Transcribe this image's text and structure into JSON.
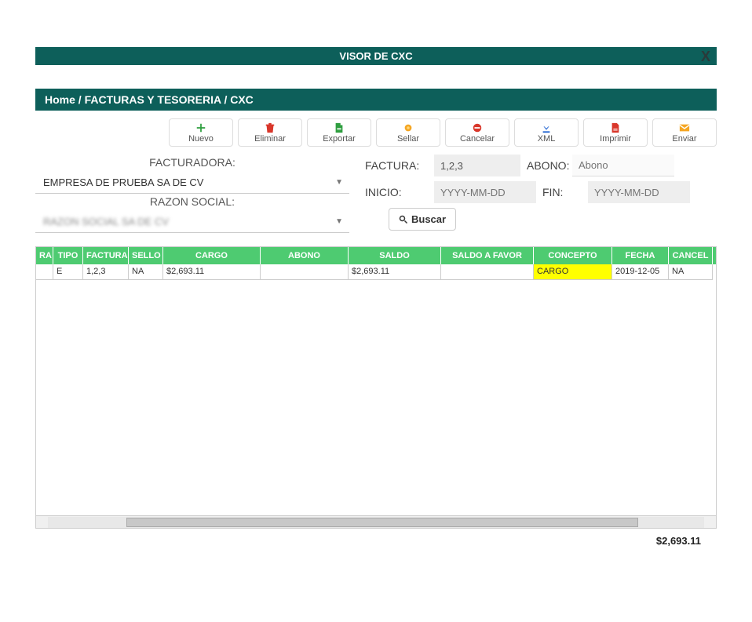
{
  "titlebar": {
    "title": "VISOR DE CXC",
    "close": "X"
  },
  "breadcrumb": "Home / FACTURAS Y TESORERIA / CXC",
  "toolbar": {
    "nuevo": "Nuevo",
    "eliminar": "Eliminar",
    "exportar": "Exportar",
    "sellar": "Sellar",
    "cancelar": "Cancelar",
    "xml": "XML",
    "imprimir": "Imprimir",
    "enviar": "Enviar"
  },
  "filters": {
    "facturadora_label": "FACTURADORA:",
    "facturadora_value": "EMPRESA DE PRUEBA SA DE CV",
    "razon_label": "RAZON SOCIAL:",
    "razon_value": "——",
    "factura_label": "FACTURA:",
    "factura_value": "1,2,3",
    "abono_label": "ABONO:",
    "abono_placeholder": "Abono",
    "inicio_label": "INICIO:",
    "inicio_placeholder": "YYYY-MM-DD",
    "fin_label": "FIN:",
    "fin_placeholder": "YYYY-MM-DD",
    "buscar": "Buscar"
  },
  "grid": {
    "headers": {
      "ra": "RA",
      "tipo": "TIPO",
      "factura": "FACTURA",
      "sello": "SELLO",
      "cargo": "CARGO",
      "abono": "ABONO",
      "saldo": "SALDO",
      "favor": "SALDO A FAVOR",
      "concepto": "CONCEPTO",
      "fecha": "FECHA",
      "cancel": "CANCEL"
    },
    "rows": [
      {
        "ra": "",
        "tipo": "E",
        "factura": "1,2,3",
        "sello": "NA",
        "cargo": "$2,693.11",
        "abono": "",
        "saldo": "$2,693.11",
        "favor": "",
        "concepto": "CARGO",
        "fecha": "2019-12-05",
        "cancel": "NA"
      }
    ]
  },
  "total": "$2,693.11",
  "icons": {
    "plus": "+",
    "search": "Q"
  }
}
